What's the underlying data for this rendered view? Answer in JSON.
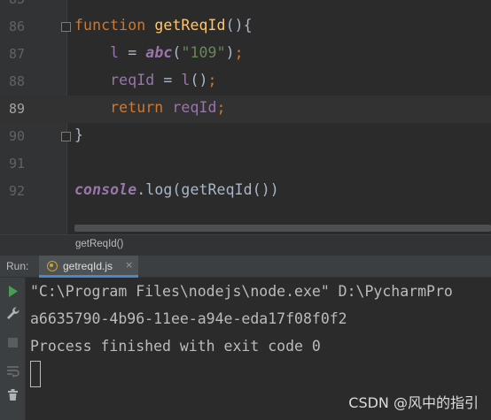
{
  "editor": {
    "lines": [
      {
        "num": "85",
        "tokens": []
      },
      {
        "num": "86",
        "tokens": [
          {
            "t": "function ",
            "c": "kw"
          },
          {
            "t": "getReqId",
            "c": "fn"
          },
          {
            "t": "(){",
            "c": "plain"
          }
        ]
      },
      {
        "num": "87",
        "tokens": [
          {
            "t": "    l",
            "c": "var"
          },
          {
            "t": " = ",
            "c": "plain"
          },
          {
            "t": "abc",
            "c": "italic-fn"
          },
          {
            "t": "(",
            "c": "plain"
          },
          {
            "t": "\"109\"",
            "c": "str"
          },
          {
            "t": ")",
            "c": "plain"
          },
          {
            "t": ";",
            "c": "semi"
          }
        ]
      },
      {
        "num": "88",
        "tokens": [
          {
            "t": "    reqId",
            "c": "var"
          },
          {
            "t": " = ",
            "c": "plain"
          },
          {
            "t": "l",
            "c": "var"
          },
          {
            "t": "()",
            "c": "plain"
          },
          {
            "t": ";",
            "c": "semi"
          }
        ]
      },
      {
        "num": "89",
        "tokens": [
          {
            "t": "    return ",
            "c": "kw"
          },
          {
            "t": "reqId",
            "c": "var"
          },
          {
            "t": ";",
            "c": "semi"
          }
        ]
      },
      {
        "num": "90",
        "tokens": [
          {
            "t": "}",
            "c": "plain"
          }
        ]
      },
      {
        "num": "91",
        "tokens": []
      },
      {
        "num": "92",
        "tokens": [
          {
            "t": "console",
            "c": "obj"
          },
          {
            "t": ".log(",
            "c": "plain"
          },
          {
            "t": "getReqId",
            "c": "plain"
          },
          {
            "t": "())",
            "c": "plain"
          }
        ]
      }
    ],
    "current_line": "89"
  },
  "breadcrumb": "getReqId()",
  "run": {
    "label": "Run:",
    "tab_name": "getreqId.js",
    "tab_close": "×"
  },
  "console": {
    "lines": [
      "\"C:\\Program Files\\nodejs\\node.exe\" D:\\PycharmPro",
      "a6635790-4b96-11ee-a94e-eda17f08f0f2",
      "Process finished with exit code 0"
    ]
  },
  "watermark": "CSDN @风中的指引",
  "colors": {
    "keyword": "#cc7832",
    "function": "#ffc66d",
    "variable": "#9876aa",
    "string": "#6a8759",
    "text": "#a9b7c6",
    "run_green": "#499c54",
    "accent_tab": "#4a88c7"
  },
  "icons": [
    "run-icon",
    "wrench-icon",
    "stop-icon",
    "soft-wrap-icon",
    "trash-icon",
    "js-file-icon",
    "fold-marker-icon"
  ]
}
